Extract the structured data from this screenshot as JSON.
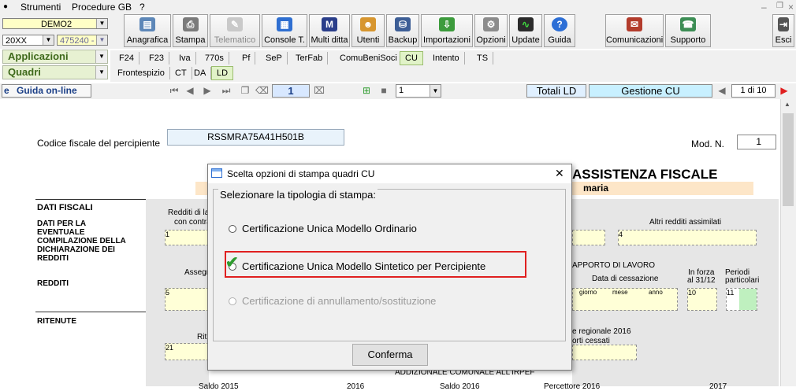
{
  "menu": {
    "items": [
      "Strumenti",
      "Procedure GB",
      "?"
    ]
  },
  "selectors": {
    "company": "DEMO2",
    "year": "20XX",
    "code": "475240 -"
  },
  "sections": {
    "applicazioni": "Applicazioni",
    "quadri": "Quadri"
  },
  "toolbar": {
    "buttons": [
      "Anagrafica",
      "Stampa",
      "Telematico",
      "Console T.",
      "Multi ditta",
      "Utenti",
      "Backup",
      "Importazioni",
      "Opzioni",
      "Update",
      "Guida"
    ],
    "right_buttons": [
      "Comunicazioni",
      "Supporto"
    ],
    "exit": "Esci",
    "multi_icon_letter": "M"
  },
  "tabs_top": [
    "F24",
    "F23",
    "Iva",
    "770s",
    "Pf",
    "SeP",
    "TerFab",
    "ComuBeniSoci",
    "CU",
    "Intento",
    "TS"
  ],
  "tabs_quadri": [
    "Frontespizio",
    "CT",
    "DA",
    "LD"
  ],
  "nav": {
    "guida_online": "Guida on-line",
    "page_field": "1",
    "dropdown_value": "1",
    "totali": "Totali LD",
    "gestione": "Gestione CU",
    "page_counter": "1 di 10"
  },
  "form": {
    "cf_label": "Codice fiscale del percipiente",
    "cf_value": "RSSMRA75A41H501B",
    "modn_label": "Mod. N.",
    "modn_value": "1",
    "assistenza": "ASSISTENZA FISCALE",
    "name": "maria",
    "dati_fiscali": "DATI FISCALI",
    "dati_eventuale": "DATI PER LA EVENTUALE COMPILAZIONE DELLA DICHIARAZIONE DEI REDDITI",
    "redditi": "REDDITI",
    "ritenute": "RITENUTE",
    "redditi_di_la": "Redditi di la",
    "con_contr": "con contra",
    "altri_redditi": "Altri redditi assimilati",
    "rapporto_lavoro": "APPORTO DI LAVORO",
    "data_cessazione": "Data di cessazione",
    "giorno": "giorno",
    "mese": "mese",
    "anno": "anno",
    "in_forza": "In forza",
    "al_31_12": "al 31/12",
    "periodi": "Periodi",
    "particolari": "particolari",
    "assegn": "Assegn",
    "rit": "Rit",
    "regionale": "e regionale 2016",
    "orti_cessati": "orti cessati",
    "addizionale": "ADDIZIONALE COMUNALE ALL'IRPEF",
    "field_nums": [
      "1",
      "4",
      "5",
      "10",
      "11",
      "21"
    ],
    "bottom_texts": [
      "Saldo 2015",
      "2016",
      "Saldo 2016",
      "Percettore 2016",
      "2017"
    ]
  },
  "dialog": {
    "title": "Scelta opzioni di stampa quadri CU",
    "group_label": "Selezionare la tipologia di stampa:",
    "options": [
      "Certificazione Unica Modello Ordinario",
      "Certificazione Unica Modello Sintetico per Percipiente",
      "Certificazione di annullamento/sostituzione"
    ],
    "selected_index": 1,
    "confirm": "Conferma",
    "close_glyph": "✕"
  },
  "colors": {
    "accent": "#1b3f87",
    "highlight_red": "#e02020",
    "check_green": "#2f9c2f",
    "field_yellow": "#ffffd7",
    "name_orange": "#fde6c8"
  }
}
